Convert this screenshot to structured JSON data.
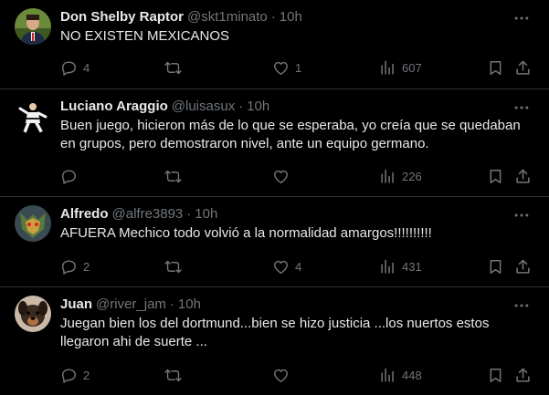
{
  "tweets": [
    {
      "name": "Don Shelby Raptor",
      "handle": "@skt1minato",
      "time": "10h",
      "text": "NO EXISTEN MEXICANOS",
      "replies": "4",
      "retweets": "",
      "likes": "1",
      "views": "607"
    },
    {
      "name": "Luciano Araggio",
      "handle": "@luisasux",
      "time": "10h",
      "text": "Buen juego, hicieron más de lo que se esperaba, yo creía que se quedaban en grupos, pero demostraron nivel, ante un equipo germano.",
      "replies": "",
      "retweets": "",
      "likes": "",
      "views": "226"
    },
    {
      "name": "Alfredo",
      "handle": "@alfre3893",
      "time": "10h",
      "text": "AFUERA Mechico todo volvió a la normalidad amargos!!!!!!!!!!",
      "replies": "2",
      "retweets": "",
      "likes": "4",
      "views": "431"
    },
    {
      "name": "Juan",
      "handle": "@river_jam",
      "time": "10h",
      "text": "Juegan bien los del dortmund...bien se hizo justicia ...los nuertos estos llegaron ahi de suerte ...",
      "replies": "2",
      "retweets": "",
      "likes": "",
      "views": "448"
    }
  ],
  "icons": {
    "reply": "reply-icon",
    "retweet": "retweet-icon",
    "like": "heart-icon",
    "views": "views-icon",
    "bookmark": "bookmark-icon",
    "share": "share-icon",
    "more": "more-icon"
  },
  "colors": {
    "background": "#000000",
    "text": "#e7e9ea",
    "secondary": "#71767b",
    "divider": "#2f3336"
  }
}
